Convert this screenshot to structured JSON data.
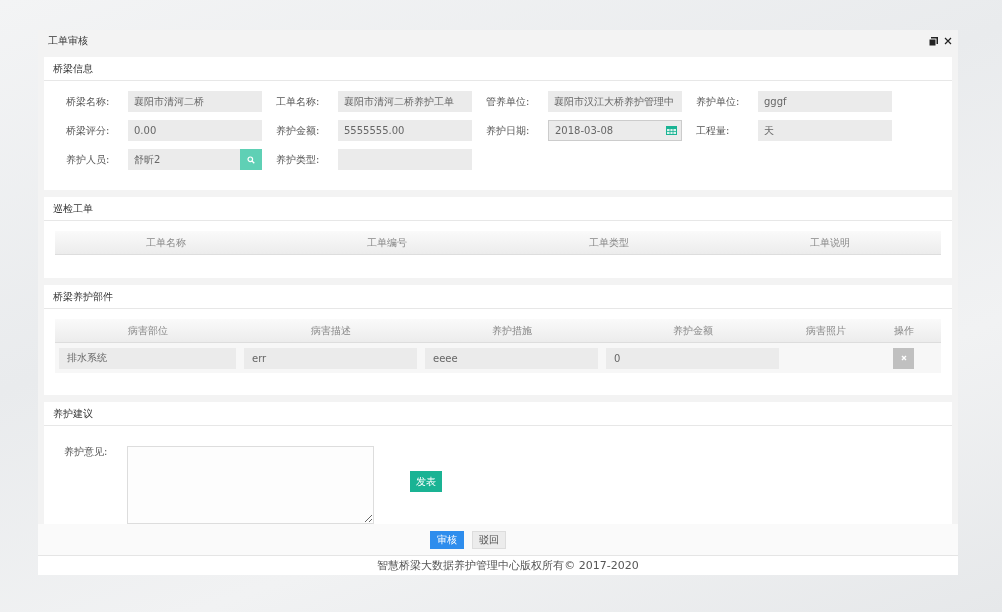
{
  "window": {
    "title": "工单审核"
  },
  "bridge_info": {
    "title": "桥梁信息",
    "fields": [
      {
        "label": "桥梁名称:",
        "value": "襄阳市清河二桥",
        "kind": "text"
      },
      {
        "label": "工单名称:",
        "value": "襄阳市清河二桥养护工单",
        "kind": "text"
      },
      {
        "label": "管养单位:",
        "value": "襄阳市汉江大桥养护管理中",
        "kind": "text"
      },
      {
        "label": "养护单位:",
        "value": "gggf",
        "kind": "text"
      },
      {
        "label": "桥梁评分:",
        "value": "0.00",
        "kind": "text"
      },
      {
        "label": "养护金额:",
        "value": "5555555.00",
        "kind": "text"
      },
      {
        "label": "养护日期:",
        "value": "2018-03-08",
        "kind": "date"
      },
      {
        "label": "工程量:",
        "value": "天",
        "kind": "text"
      },
      {
        "label": "养护人员:",
        "value": "舒昕2",
        "kind": "search"
      },
      {
        "label": "养护类型:",
        "kind": "text"
      }
    ]
  },
  "inspection": {
    "title": "巡检工单",
    "columns": [
      "工单名称",
      "工单编号",
      "工单类型",
      "工单说明"
    ]
  },
  "parts": {
    "title": "桥梁养护部件",
    "columns": [
      "病害部位",
      "病害描述",
      "养护措施",
      "养护金额",
      "病害照片",
      "操作"
    ],
    "rows": [
      {
        "location": "排水系统",
        "description": "err",
        "measure": "eeee",
        "amount": "0"
      }
    ]
  },
  "advice": {
    "title": "养护建议",
    "label": "养护意见:",
    "button": "发表"
  },
  "actions": [
    "审核",
    "驳回"
  ],
  "footer": "智慧桥梁大数据养护管理中心版权所有© 2017-2020"
}
